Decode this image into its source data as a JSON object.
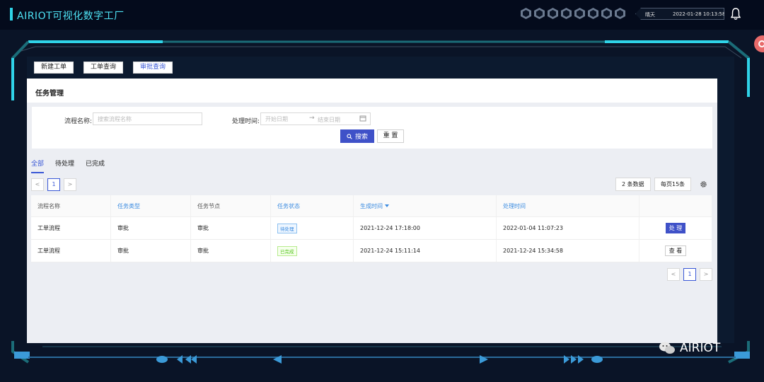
{
  "header": {
    "title": "AIRIOT可视化数字工厂",
    "weather": "晴天",
    "datetime": "2022-01-28 10:13:58",
    "hex_icons": [
      "send-icon",
      "tag-icon",
      "video-icon",
      "send-icon",
      "tag-icon",
      "send-icon",
      "tag-icon",
      "video-icon"
    ]
  },
  "top_buttons": {
    "new_order": "新建工单",
    "order_query": "工单查询",
    "approval_query": "审批查询"
  },
  "page": {
    "title": "任务管理"
  },
  "filter": {
    "flow_name_label": "流程名称:",
    "flow_name_placeholder": "搜索流程名称",
    "time_label": "处理时间:",
    "start_placeholder": "开始日期",
    "separator": "→",
    "end_placeholder": "结束日期",
    "search_label": "搜索",
    "reset_label": "重 置"
  },
  "tabs": [
    {
      "label": "全部",
      "active": true
    },
    {
      "label": "待处理",
      "active": false
    },
    {
      "label": "已完成",
      "active": false
    }
  ],
  "pager": {
    "prev": "<",
    "current": "1",
    "next": ">"
  },
  "toolbar": {
    "count": "2 条数据",
    "page_size": "每页15条"
  },
  "table": {
    "columns": [
      "流程名称",
      "任务类型",
      "任务节点",
      "任务状态",
      "生成时间",
      "处理时间",
      ""
    ],
    "rows": [
      {
        "name": "工单流程",
        "type": "审批",
        "node": "审批",
        "status": "待处理",
        "status_kind": "pending",
        "created": "2021-12-24 17:18:00",
        "handled": "2022-01-04 11:07:23",
        "action": "处 理",
        "action_kind": "primary"
      },
      {
        "name": "工单流程",
        "type": "审批",
        "node": "审批",
        "status": "已完成",
        "status_kind": "done",
        "created": "2021-12-24 15:11:14",
        "handled": "2021-12-24 15:34:58",
        "action": "查 看",
        "action_kind": "default"
      }
    ]
  },
  "bottom_pager": {
    "prev": "<",
    "current": "1",
    "next": ">"
  },
  "watermark": {
    "text": "AIRIOT"
  },
  "colors": {
    "accent": "#3f51c8",
    "cyan": "#2fd3e8",
    "link": "#3a8be0"
  }
}
